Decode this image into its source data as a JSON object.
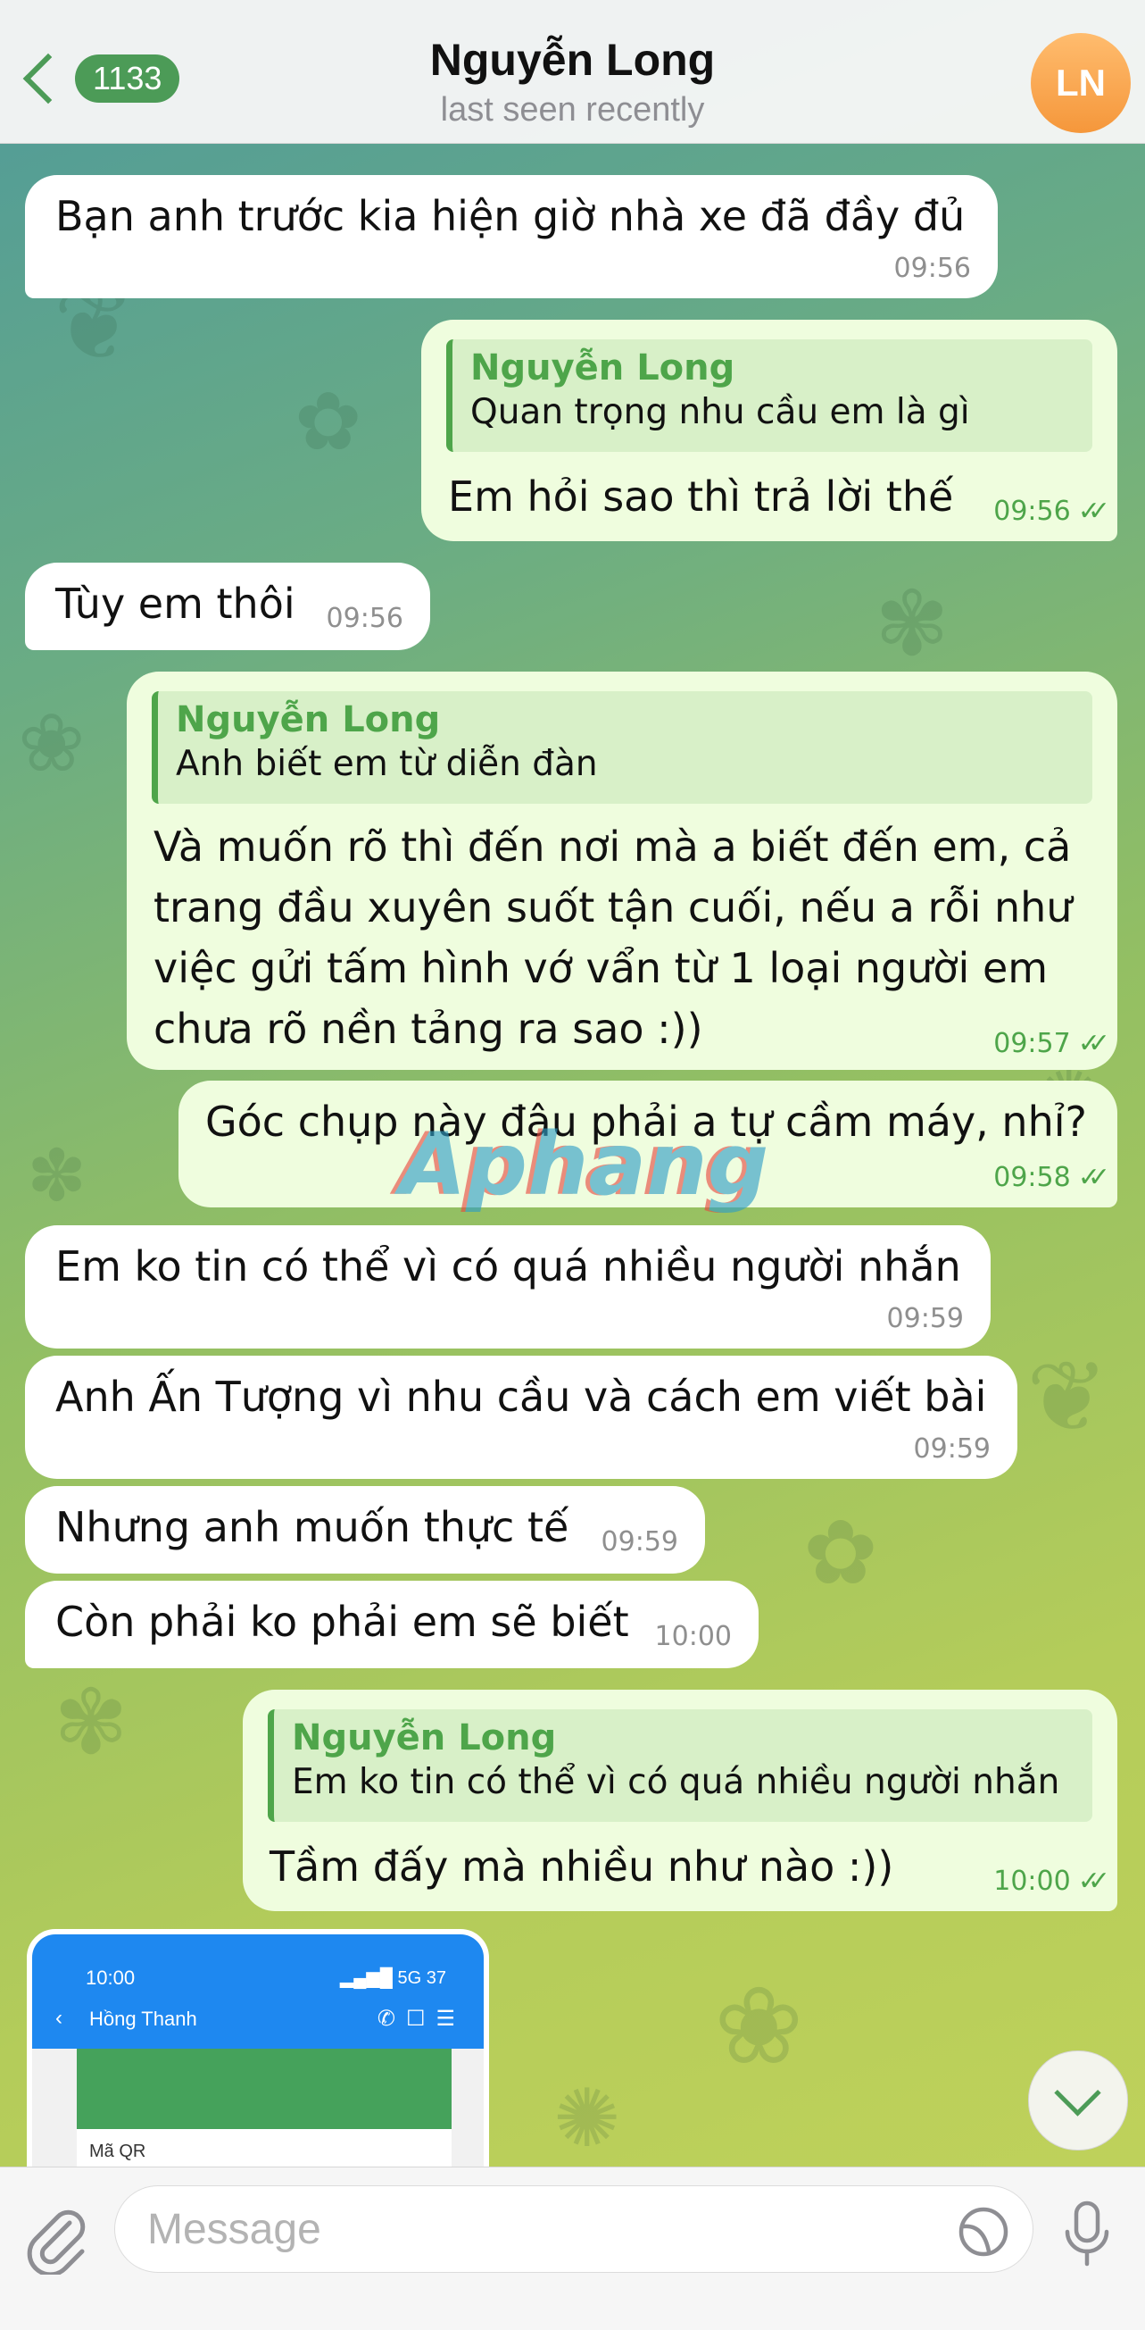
{
  "header": {
    "back_count": "1133",
    "title": "Nguyễn Long",
    "status": "last seen recently",
    "avatar_initials": "LN"
  },
  "messages": [
    {
      "id": "m1",
      "dir": "in",
      "text": "Bạn anh trước kia hiện giờ nhà xe đã đầy đủ",
      "time": "09:56"
    },
    {
      "id": "m2",
      "dir": "out",
      "reply_name": "Nguyễn Long",
      "reply_text": "Quan trọng nhu cầu em là gì",
      "text": "Em hỏi sao thì trả lời thế",
      "time": "09:56"
    },
    {
      "id": "m3",
      "dir": "in",
      "text": "Tùy em thôi",
      "time": "09:56"
    },
    {
      "id": "m4",
      "dir": "out",
      "reply_name": "Nguyễn Long",
      "reply_text": "Anh biết em từ diễn đàn",
      "lines": [
        "Và muốn rõ thì đến nơi mà a biết đến em, cả",
        "trang đầu xuyên suốt tận cuối, nếu a rỗi như",
        "việc gửi tấm hình vớ vẩn từ 1 loại người em",
        "chưa rõ nền tảng ra sao :))"
      ],
      "time": "09:57"
    },
    {
      "id": "m5",
      "dir": "out",
      "text": "Góc chụp này đâu phải a tự cầm máy, nhỉ?",
      "time": "09:58"
    },
    {
      "id": "m6",
      "dir": "in",
      "text": "Em ko tin có thể vì có quá nhiều người nhắn",
      "time": "09:59"
    },
    {
      "id": "m7",
      "dir": "in",
      "text": "Anh Ấn Tượng vì nhu cầu và cách em viết bài",
      "time": "09:59"
    },
    {
      "id": "m8",
      "dir": "in",
      "text": "Nhưng anh muốn thực tế",
      "time": "09:59"
    },
    {
      "id": "m9",
      "dir": "in",
      "text": "Còn phải ko phải em sẽ biết",
      "time": "10:00"
    },
    {
      "id": "m10",
      "dir": "out",
      "reply_name": "Nguyễn Long",
      "reply_text": "Em ko tin có thể vì có quá nhiều người nhắn",
      "text": "Tầm đấy mà nhiều như nào :))",
      "time": "10:00"
    }
  ],
  "read_ticks": "✓✓",
  "watermark": "Aphang",
  "image_message": {
    "time": "10:00",
    "network": "5G",
    "battery": "37",
    "contact": "Hồng Thanh",
    "qr_label": "Mã QR"
  },
  "input": {
    "placeholder": "Message"
  },
  "icons": {
    "back": "chevron-left-icon",
    "attach": "paperclip-icon",
    "sticker": "sticker-icon",
    "mic": "microphone-icon",
    "scroll": "chevron-down-icon"
  },
  "colors": {
    "accent": "#4c9b57",
    "incoming_bubble": "#ffffff",
    "outgoing_bubble": "#effdde",
    "avatar": "#f5973b"
  }
}
